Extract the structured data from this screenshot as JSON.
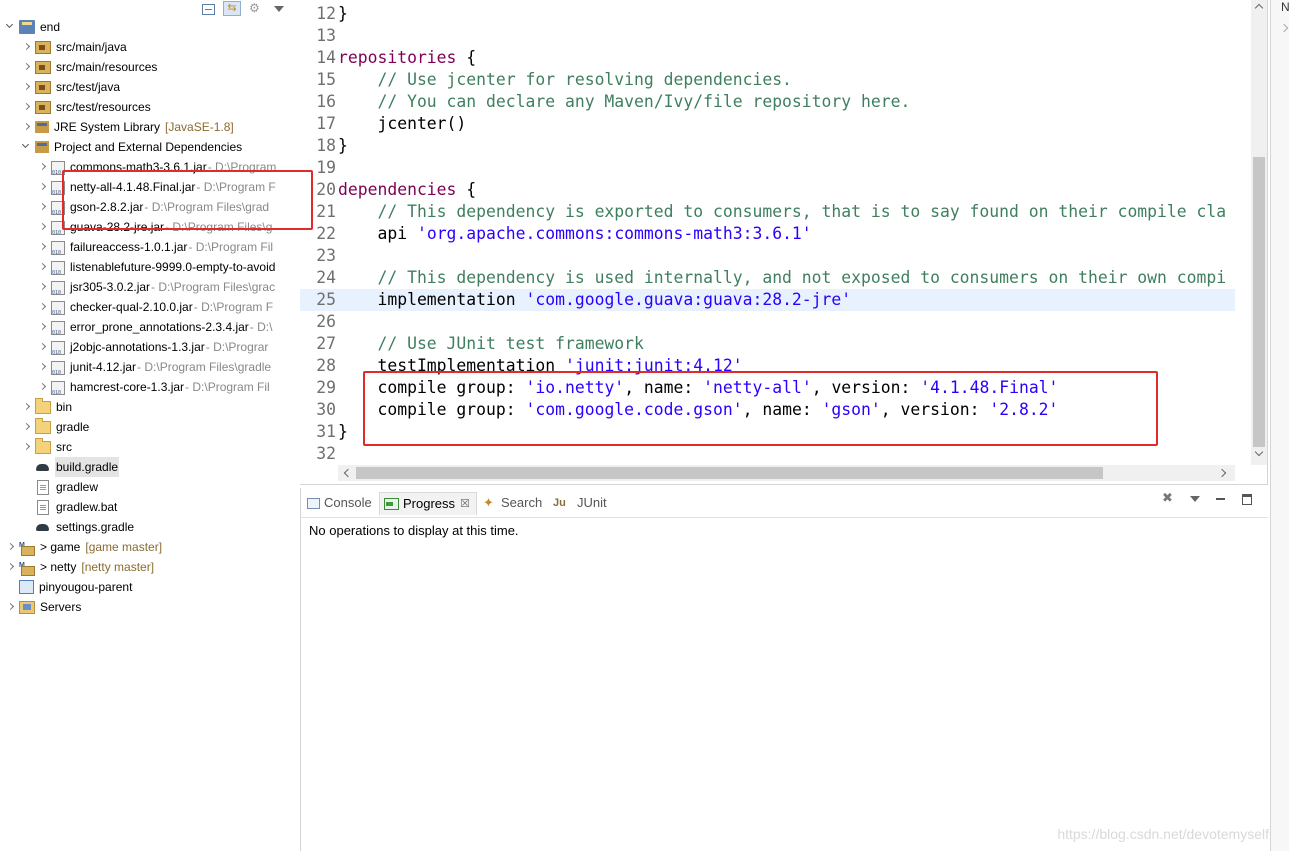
{
  "explorer": {
    "items": [
      {
        "label": "end",
        "decoration": "",
        "path": "",
        "depth": 0,
        "twisty": "open",
        "icon": "project"
      },
      {
        "label": "src/main/java",
        "decoration": "",
        "path": "",
        "depth": 1,
        "twisty": "closed",
        "icon": "srcfolder"
      },
      {
        "label": "src/main/resources",
        "decoration": "",
        "path": "",
        "depth": 1,
        "twisty": "closed",
        "icon": "srcfolder"
      },
      {
        "label": "src/test/java",
        "decoration": "",
        "path": "",
        "depth": 1,
        "twisty": "closed",
        "icon": "srcfolder"
      },
      {
        "label": "src/test/resources",
        "decoration": "",
        "path": "",
        "depth": 1,
        "twisty": "closed",
        "icon": "srcfolder"
      },
      {
        "label": "JRE System Library",
        "decoration": "[JavaSE-1.8]",
        "path": "",
        "depth": 1,
        "twisty": "closed",
        "icon": "library"
      },
      {
        "label": "Project and External Dependencies",
        "decoration": "",
        "path": "",
        "depth": 1,
        "twisty": "open",
        "icon": "library"
      },
      {
        "label": "commons-math3-3.6.1.jar",
        "decoration": "",
        "path": " - D:\\Program",
        "depth": 2,
        "twisty": "closed",
        "icon": "jar"
      },
      {
        "label": "netty-all-4.1.48.Final.jar",
        "decoration": "",
        "path": " - D:\\Program F",
        "depth": 2,
        "twisty": "closed",
        "icon": "jar"
      },
      {
        "label": "gson-2.8.2.jar",
        "decoration": "",
        "path": " - D:\\Program Files\\grad",
        "depth": 2,
        "twisty": "closed",
        "icon": "jar"
      },
      {
        "label": "guava-28.2-jre.jar",
        "decoration": "",
        "path": " - D:\\Program Files\\g",
        "depth": 2,
        "twisty": "closed",
        "icon": "jar"
      },
      {
        "label": "failureaccess-1.0.1.jar",
        "decoration": "",
        "path": " - D:\\Program Fil",
        "depth": 2,
        "twisty": "closed",
        "icon": "jar"
      },
      {
        "label": "listenablefuture-9999.0-empty-to-avoid",
        "decoration": "",
        "path": "",
        "depth": 2,
        "twisty": "closed",
        "icon": "jar"
      },
      {
        "label": "jsr305-3.0.2.jar",
        "decoration": "",
        "path": " - D:\\Program Files\\grac",
        "depth": 2,
        "twisty": "closed",
        "icon": "jar"
      },
      {
        "label": "checker-qual-2.10.0.jar",
        "decoration": "",
        "path": " - D:\\Program F",
        "depth": 2,
        "twisty": "closed",
        "icon": "jar"
      },
      {
        "label": "error_prone_annotations-2.3.4.jar",
        "decoration": "",
        "path": " - D:\\",
        "depth": 2,
        "twisty": "closed",
        "icon": "jar"
      },
      {
        "label": "j2objc-annotations-1.3.jar",
        "decoration": "",
        "path": " - D:\\Prograr",
        "depth": 2,
        "twisty": "closed",
        "icon": "jar"
      },
      {
        "label": "junit-4.12.jar",
        "decoration": "",
        "path": " - D:\\Program Files\\gradle",
        "depth": 2,
        "twisty": "closed",
        "icon": "jar"
      },
      {
        "label": "hamcrest-core-1.3.jar",
        "decoration": "",
        "path": " - D:\\Program Fil",
        "depth": 2,
        "twisty": "closed",
        "icon": "jar"
      },
      {
        "label": "bin",
        "decoration": "",
        "path": "",
        "depth": 1,
        "twisty": "closed",
        "icon": "folder"
      },
      {
        "label": "gradle",
        "decoration": "",
        "path": "",
        "depth": 1,
        "twisty": "closed",
        "icon": "folder"
      },
      {
        "label": "src",
        "decoration": "",
        "path": "",
        "depth": 1,
        "twisty": "closed",
        "icon": "folder"
      },
      {
        "label": "build.gradle",
        "decoration": "",
        "path": "",
        "depth": 1,
        "twisty": "none",
        "icon": "gradle",
        "selected": true
      },
      {
        "label": "gradlew",
        "decoration": "",
        "path": "",
        "depth": 1,
        "twisty": "none",
        "icon": "file"
      },
      {
        "label": "gradlew.bat",
        "decoration": "",
        "path": "",
        "depth": 1,
        "twisty": "none",
        "icon": "file"
      },
      {
        "label": "settings.gradle",
        "decoration": "",
        "path": "",
        "depth": 1,
        "twisty": "none",
        "icon": "gradle"
      },
      {
        "label": "> game",
        "decoration": "[game master]",
        "path": "",
        "depth": 0,
        "twisty": "closed",
        "icon": "mvnproject"
      },
      {
        "label": "> netty",
        "decoration": "[netty master]",
        "path": "",
        "depth": 0,
        "twisty": "closed",
        "icon": "mvnproject"
      },
      {
        "label": "pinyougou-parent",
        "decoration": "",
        "path": "",
        "depth": 0,
        "twisty": "none",
        "icon": "plainproject"
      },
      {
        "label": "Servers",
        "decoration": "",
        "path": "",
        "depth": 0,
        "twisty": "closed",
        "icon": "servers"
      }
    ]
  },
  "editor": {
    "current_line": "25",
    "lines": [
      {
        "n": "12",
        "tokens": [
          {
            "t": "}",
            "c": ""
          }
        ]
      },
      {
        "n": "13",
        "tokens": []
      },
      {
        "n": "14",
        "tokens": [
          {
            "t": "repositories",
            "c": "kw"
          },
          {
            "t": " {",
            "c": ""
          }
        ]
      },
      {
        "n": "15",
        "tokens": [
          {
            "t": "    // Use jcenter for resolving dependencies.",
            "c": "cm"
          }
        ]
      },
      {
        "n": "16",
        "tokens": [
          {
            "t": "    // You can declare any Maven/Ivy/file repository here.",
            "c": "cm"
          }
        ]
      },
      {
        "n": "17",
        "tokens": [
          {
            "t": "    jcenter()",
            "c": ""
          }
        ]
      },
      {
        "n": "18",
        "tokens": [
          {
            "t": "}",
            "c": ""
          }
        ]
      },
      {
        "n": "19",
        "tokens": []
      },
      {
        "n": "20",
        "tokens": [
          {
            "t": "dependencies",
            "c": "kw"
          },
          {
            "t": " {",
            "c": ""
          }
        ]
      },
      {
        "n": "21",
        "tokens": [
          {
            "t": "    // This dependency is exported to consumers, that is to say found on their compile cla",
            "c": "cm"
          }
        ]
      },
      {
        "n": "22",
        "tokens": [
          {
            "t": "    api ",
            "c": ""
          },
          {
            "t": "'org.apache.commons:commons-math3:3.6.1'",
            "c": "st"
          }
        ]
      },
      {
        "n": "23",
        "tokens": []
      },
      {
        "n": "24",
        "tokens": [
          {
            "t": "    // This dependency is used internally, and not exposed to consumers on their own compi",
            "c": "cm"
          }
        ]
      },
      {
        "n": "25",
        "tokens": [
          {
            "t": "    implementation ",
            "c": ""
          },
          {
            "t": "'com.google.guava:guava:28.2-jre'",
            "c": "st"
          }
        ]
      },
      {
        "n": "26",
        "tokens": []
      },
      {
        "n": "27",
        "tokens": [
          {
            "t": "    // Use JUnit test framework",
            "c": "cm"
          }
        ]
      },
      {
        "n": "28",
        "tokens": [
          {
            "t": "    testImplementation ",
            "c": ""
          },
          {
            "t": "'junit:junit:4.12'",
            "c": "st"
          }
        ]
      },
      {
        "n": "29",
        "tokens": [
          {
            "t": "    compile group: ",
            "c": ""
          },
          {
            "t": "'io.netty'",
            "c": "st"
          },
          {
            "t": ", name: ",
            "c": ""
          },
          {
            "t": "'netty-all'",
            "c": "st"
          },
          {
            "t": ", version: ",
            "c": ""
          },
          {
            "t": "'4.1.48.Final'",
            "c": "st"
          }
        ]
      },
      {
        "n": "30",
        "tokens": [
          {
            "t": "    compile group: ",
            "c": ""
          },
          {
            "t": "'com.google.code.gson'",
            "c": "st"
          },
          {
            "t": ", name: ",
            "c": ""
          },
          {
            "t": "'gson'",
            "c": "st"
          },
          {
            "t": ", version: ",
            "c": ""
          },
          {
            "t": "'2.8.2'",
            "c": "st"
          }
        ]
      },
      {
        "n": "31",
        "tokens": [
          {
            "t": "}",
            "c": ""
          }
        ]
      },
      {
        "n": "32",
        "tokens": []
      }
    ]
  },
  "bottom": {
    "tabs": [
      {
        "label": "Console",
        "icon": "console-icon",
        "active": false
      },
      {
        "label": "Progress",
        "icon": "progress-icon",
        "active": true
      },
      {
        "label": "Search",
        "icon": "search-icon",
        "active": false
      },
      {
        "label": "JUnit",
        "icon": "junit-icon",
        "active": false
      }
    ],
    "message": "No operations to display at this time."
  },
  "right_strip": {
    "label": "N"
  },
  "watermark": "https://blog.csdn.net/devotemyself",
  "colors": {
    "keyword": "#7f0055",
    "comment": "#3f7f5f",
    "string": "#2a00ff",
    "annotation_box": "#e12a2a",
    "current_line": "#e8f2fe"
  }
}
